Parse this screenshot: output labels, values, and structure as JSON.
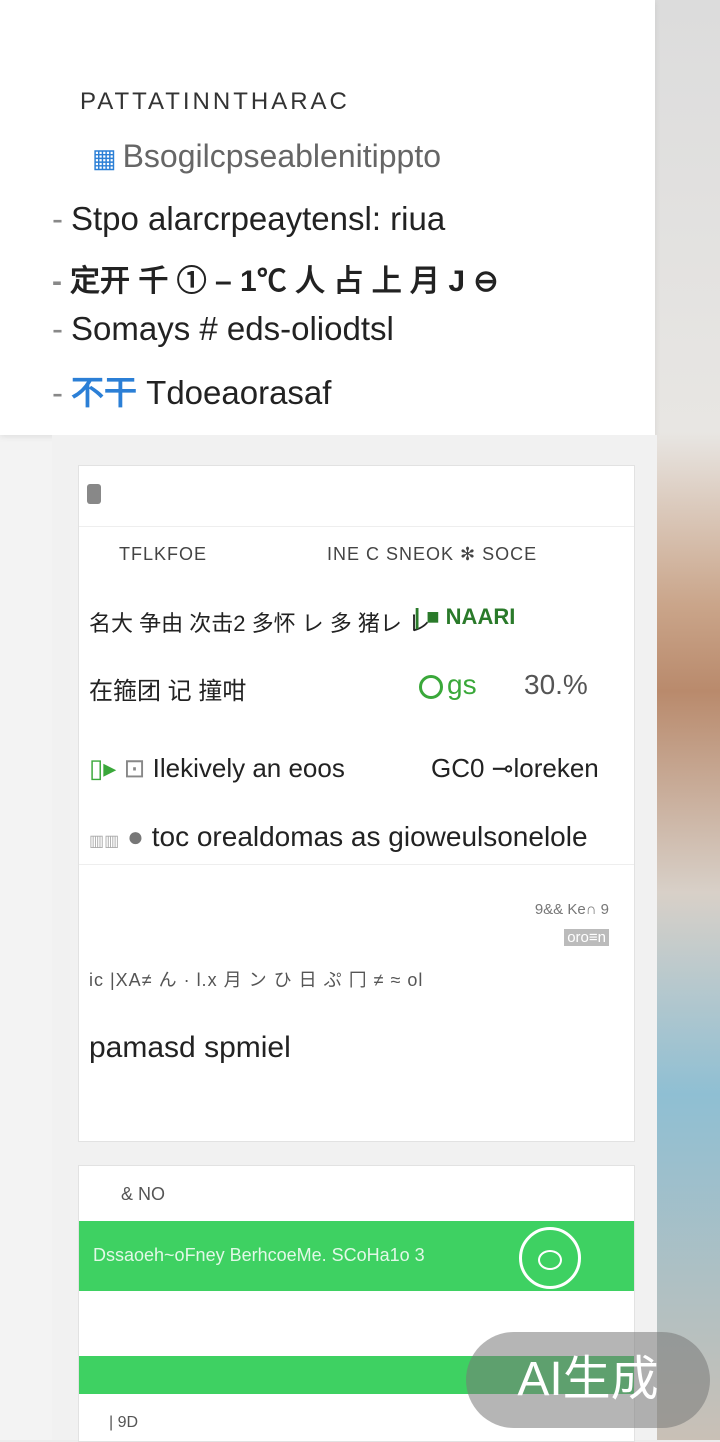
{
  "top_card": {
    "crumb": "PATTATINNTHARAC",
    "subtitle_icon": "grid-icon",
    "subtitle": "Bsogilcpseablenitippto",
    "lines": [
      "Stpo alarcrpeaytensl: riua",
      "定开 千 ① – 1℃ 人 占 上 月 J ⊖",
      "Somays # eds-oliodtsl",
      "Tdoeaorasaf"
    ],
    "line4_prefix": "不干"
  },
  "card_a": {
    "col_left": "TFLKFOE",
    "col_right": "INE C SNEOK ✻ SOCE",
    "row1": "名大 争由 次击2 多怀 レ 多 猪レ レ",
    "row1_badge": "| ■ NAARI",
    "row2": "在箍团 记 撞咁",
    "row2_status": "gs",
    "row2_pct": "30.%",
    "row3_text": "Ilekively an eoos",
    "row3_right": "GC0 ⊸loreken",
    "row4_text": "toc orealdomas as gioweulsonelole",
    "meta_line1": "9&& Ke∩ 9",
    "meta_line2": "oro≡n",
    "note": "ic |XA≠ ん · l.x 月 ン ひ 日  ぷ 冂  ≠ ≈ ol",
    "big_text": "pamasd spmiel"
  },
  "card_b": {
    "label": "& NO",
    "bar_text": "Dssaoeh~oFney BerhcoeMe. SCoHa1o 3",
    "footer": "| 9D"
  },
  "ai_badge": "AI生成",
  "colors": {
    "accent_green": "#3ed162",
    "link_blue": "#2b7fd6"
  }
}
